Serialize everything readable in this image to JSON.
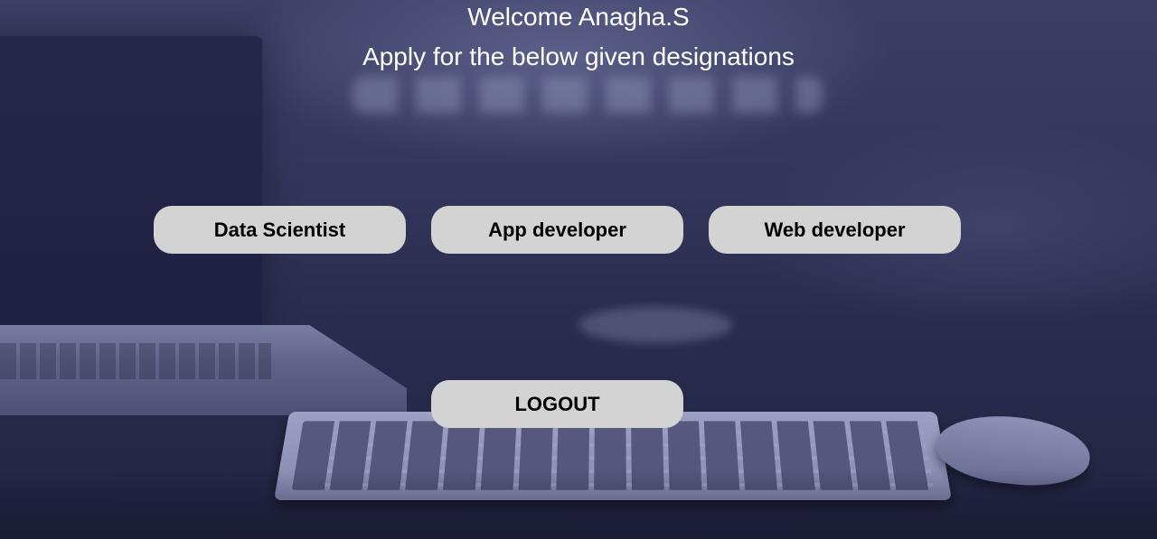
{
  "header": {
    "welcome": "Welcome Anagha.S",
    "subtitle": "Apply for the below given designations"
  },
  "designations": [
    {
      "label": "Data Scientist"
    },
    {
      "label": "App developer"
    },
    {
      "label": "Web developer"
    }
  ],
  "logout": {
    "label": "LOGOUT"
  },
  "colors": {
    "button_background": "#d3d3d3",
    "button_text": "#000000",
    "heading_text": "#ffffff",
    "background_tint": "#2f3257"
  }
}
